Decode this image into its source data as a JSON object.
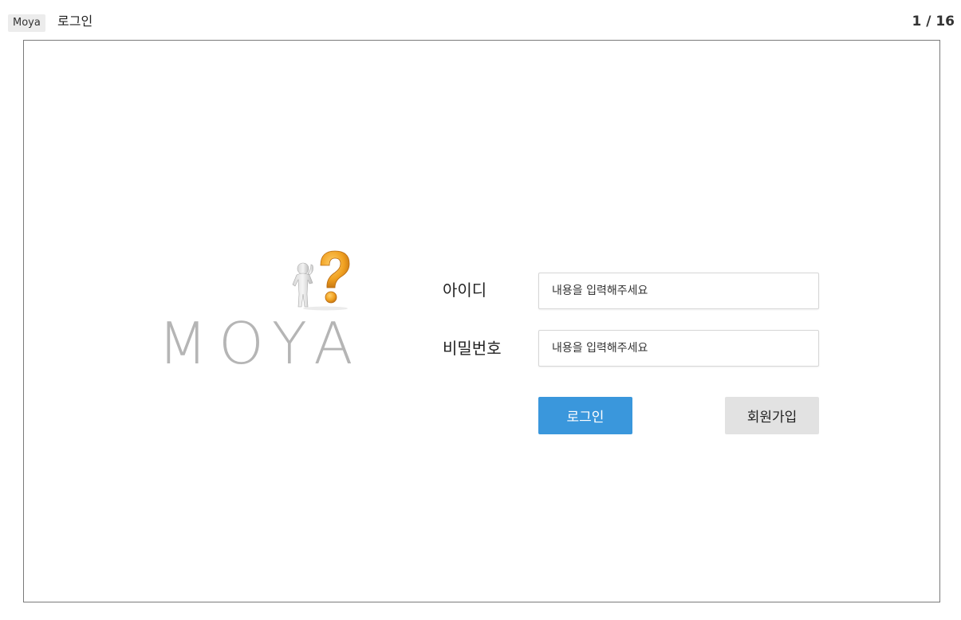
{
  "header": {
    "app_name": "Moya",
    "screen_title": "로그인",
    "page_counter": "1 / 16"
  },
  "logo": {
    "text": "MOYA",
    "figure_icon": "person-question-mark-icon"
  },
  "form": {
    "id_label": "아이디",
    "id_placeholder": "내용을 입력해주세요",
    "password_label": "비밀번호",
    "password_placeholder": "내용을 입력해주세요",
    "login_button": "로그인",
    "signup_button": "회원가입"
  },
  "colors": {
    "primary": "#3a97dc",
    "secondary_button": "#e2e2e2",
    "logo_text": "#b5b5b5",
    "logo_accent": "#f0a020"
  }
}
